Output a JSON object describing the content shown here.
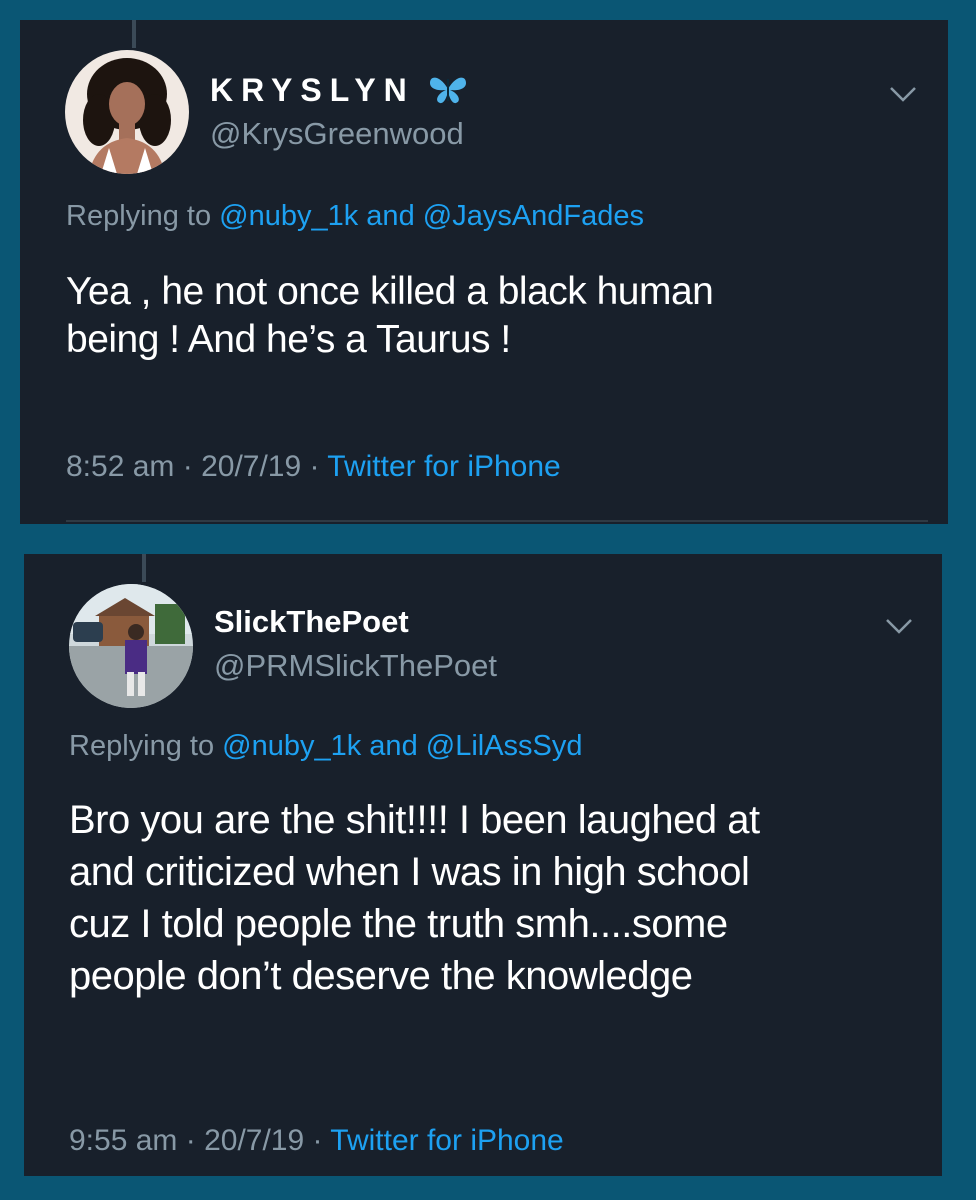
{
  "tweets": [
    {
      "name": "KRYSLYN",
      "handle": "@KrysGreenwood",
      "reply_prefix": "Replying to ",
      "reply_user1": "@nuby_1k",
      "reply_and": " and ",
      "reply_user2": "@JaysAndFades",
      "text_line1": "Yea , he not once killed a black human",
      "text_line2": "being ! And he’s a Taurus !",
      "time": "8:52 am",
      "sep1": " · ",
      "date": "20/7/19",
      "sep2": " · ",
      "source": "Twitter for iPhone"
    },
    {
      "name": "SlickThePoet",
      "handle": "@PRMSlickThePoet",
      "reply_prefix": "Replying to ",
      "reply_user1": "@nuby_1k",
      "reply_and": " and ",
      "reply_user2": "@LilAssSyd",
      "text_line1": "Bro you are the shit!!!! I been laughed at",
      "text_line2": "and criticized when I was in high school",
      "text_line3": "cuz I told people the truth smh....some",
      "text_line4": "people don’t deserve the knowledge",
      "time": "9:55 am",
      "sep1": " · ",
      "date": "20/7/19",
      "sep2": " · ",
      "source": "Twitter for iPhone"
    }
  ],
  "icons": {
    "emoji": "butterfly-icon",
    "menu": "chevron-down-icon"
  },
  "colors": {
    "background": "#0a5674",
    "card": "#18202b",
    "text": "#ffffff",
    "secondary": "#8899a6",
    "link": "#1da1f2"
  }
}
